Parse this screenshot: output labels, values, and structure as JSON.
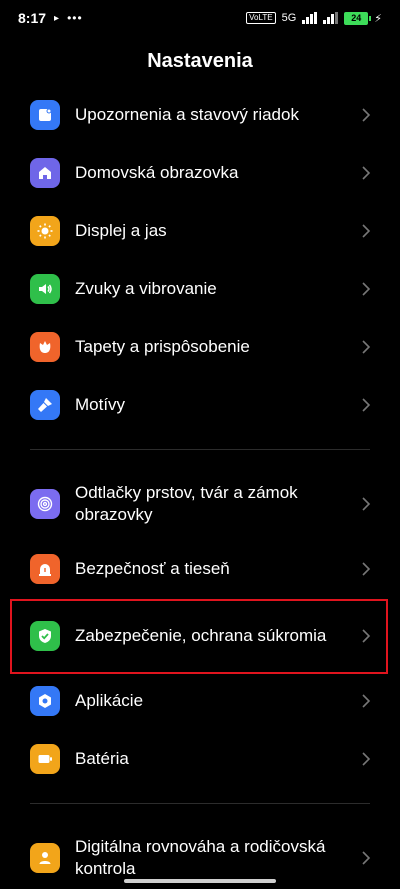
{
  "status_bar": {
    "time": "8:17",
    "network": "5G",
    "battery": "24"
  },
  "page_title": "Nastavenia",
  "items": [
    {
      "label": "Upozornenia a stavový riadok",
      "icon": "notification-icon",
      "color": "#3478f6"
    },
    {
      "label": "Domovská obrazovka",
      "icon": "home-icon",
      "color": "#6f66e8"
    },
    {
      "label": "Displej a jas",
      "icon": "sun-icon",
      "color": "#f2a51a"
    },
    {
      "label": "Zvuky a vibrovanie",
      "icon": "speaker-icon",
      "color": "#2fbf4a"
    },
    {
      "label": "Tapety a prispôsobenie",
      "icon": "flower-icon",
      "color": "#f0642b"
    },
    {
      "label": "Motívy",
      "icon": "brush-icon",
      "color": "#3478f6"
    },
    {
      "label": "Odtlačky prstov, tvár a zámok obrazovky",
      "icon": "fingerprint-icon",
      "color": "#7b6cf0"
    },
    {
      "label": "Bezpečnosť a tieseň",
      "icon": "alarm-icon",
      "color": "#f0642b"
    },
    {
      "label": "Zabezpečenie, ochrana súkromia",
      "icon": "shield-check-icon",
      "color": "#2fbf4a"
    },
    {
      "label": "Aplikácie",
      "icon": "apps-icon",
      "color": "#3478f6"
    },
    {
      "label": "Batéria",
      "icon": "battery-icon",
      "color": "#f2a51a"
    },
    {
      "label": "Digitálna rovnováha a rodičovská kontrola",
      "icon": "person-icon",
      "color": "#f2a51a"
    }
  ]
}
